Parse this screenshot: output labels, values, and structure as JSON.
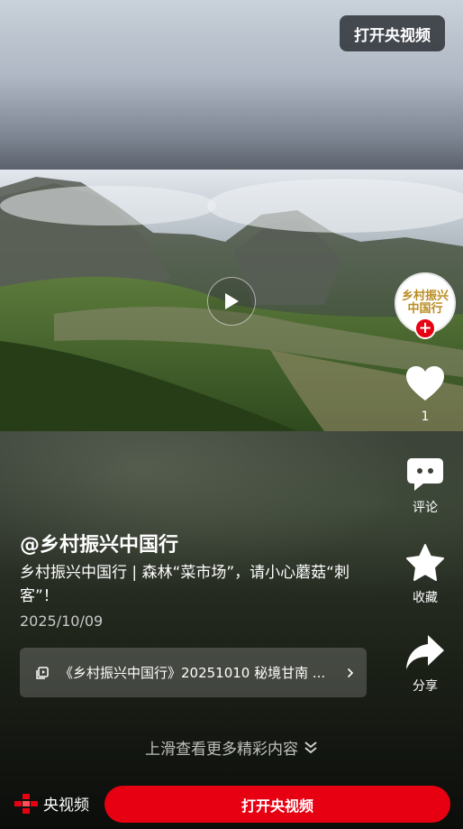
{
  "top_button": {
    "label": "打开央视频"
  },
  "video": {
    "play_icon": "play-icon"
  },
  "rail": {
    "avatar_logo_line1": "乡村振兴",
    "avatar_logo_line2": "中国行",
    "like": {
      "icon": "heart-icon",
      "count": "1"
    },
    "comment": {
      "icon": "comment-icon",
      "label": "评论"
    },
    "favorite": {
      "icon": "star-icon",
      "label": "收藏"
    },
    "share": {
      "icon": "share-icon",
      "label": "分享"
    }
  },
  "post": {
    "author": "@乡村振兴中国行",
    "description": "乡村振兴中国行 | 森林“菜市场”，请小心蘑菇“刺客”！",
    "date": "2025/10/09",
    "collection_title": "《乡村振兴中国行》20251010 秘境甘南 ..."
  },
  "swipe_hint": "上滑查看更多精彩内容",
  "bottom": {
    "brand": "央视频",
    "open_button": "打开央视频"
  },
  "colors": {
    "accent": "#e60012"
  }
}
